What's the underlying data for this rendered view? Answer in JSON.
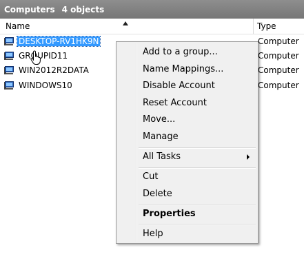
{
  "header": {
    "title": "Computers",
    "count": "4 objects"
  },
  "columns": {
    "name": "Name",
    "type": "Type"
  },
  "rows": [
    {
      "name": "DESKTOP-RV1HK9N",
      "type": "Computer",
      "selected": true
    },
    {
      "name": "GROUPID11",
      "type": "Computer",
      "selected": false
    },
    {
      "name": "WIN2012R2DATA",
      "type": "Computer",
      "selected": false
    },
    {
      "name": "WINDOWS10",
      "type": "Computer",
      "selected": false
    }
  ],
  "icons": {
    "row_icon": "computer-icon",
    "sort": "sort-ascending-icon",
    "cursor": "hand-pointer-icon",
    "submenu": "submenu-arrow-icon"
  },
  "context_menu": {
    "items": [
      {
        "label": "Add to a group..."
      },
      {
        "label": "Name Mappings..."
      },
      {
        "label": "Disable Account"
      },
      {
        "label": "Reset Account"
      },
      {
        "label": "Move..."
      },
      {
        "label": "Manage"
      },
      {
        "label": "All Tasks",
        "submenu": true
      },
      {
        "label": "Cut"
      },
      {
        "label": "Delete"
      },
      {
        "label": "Properties",
        "bold": true
      },
      {
        "label": "Help"
      }
    ]
  },
  "colors": {
    "selection": "#3399ff",
    "header_bar": "#808080"
  }
}
